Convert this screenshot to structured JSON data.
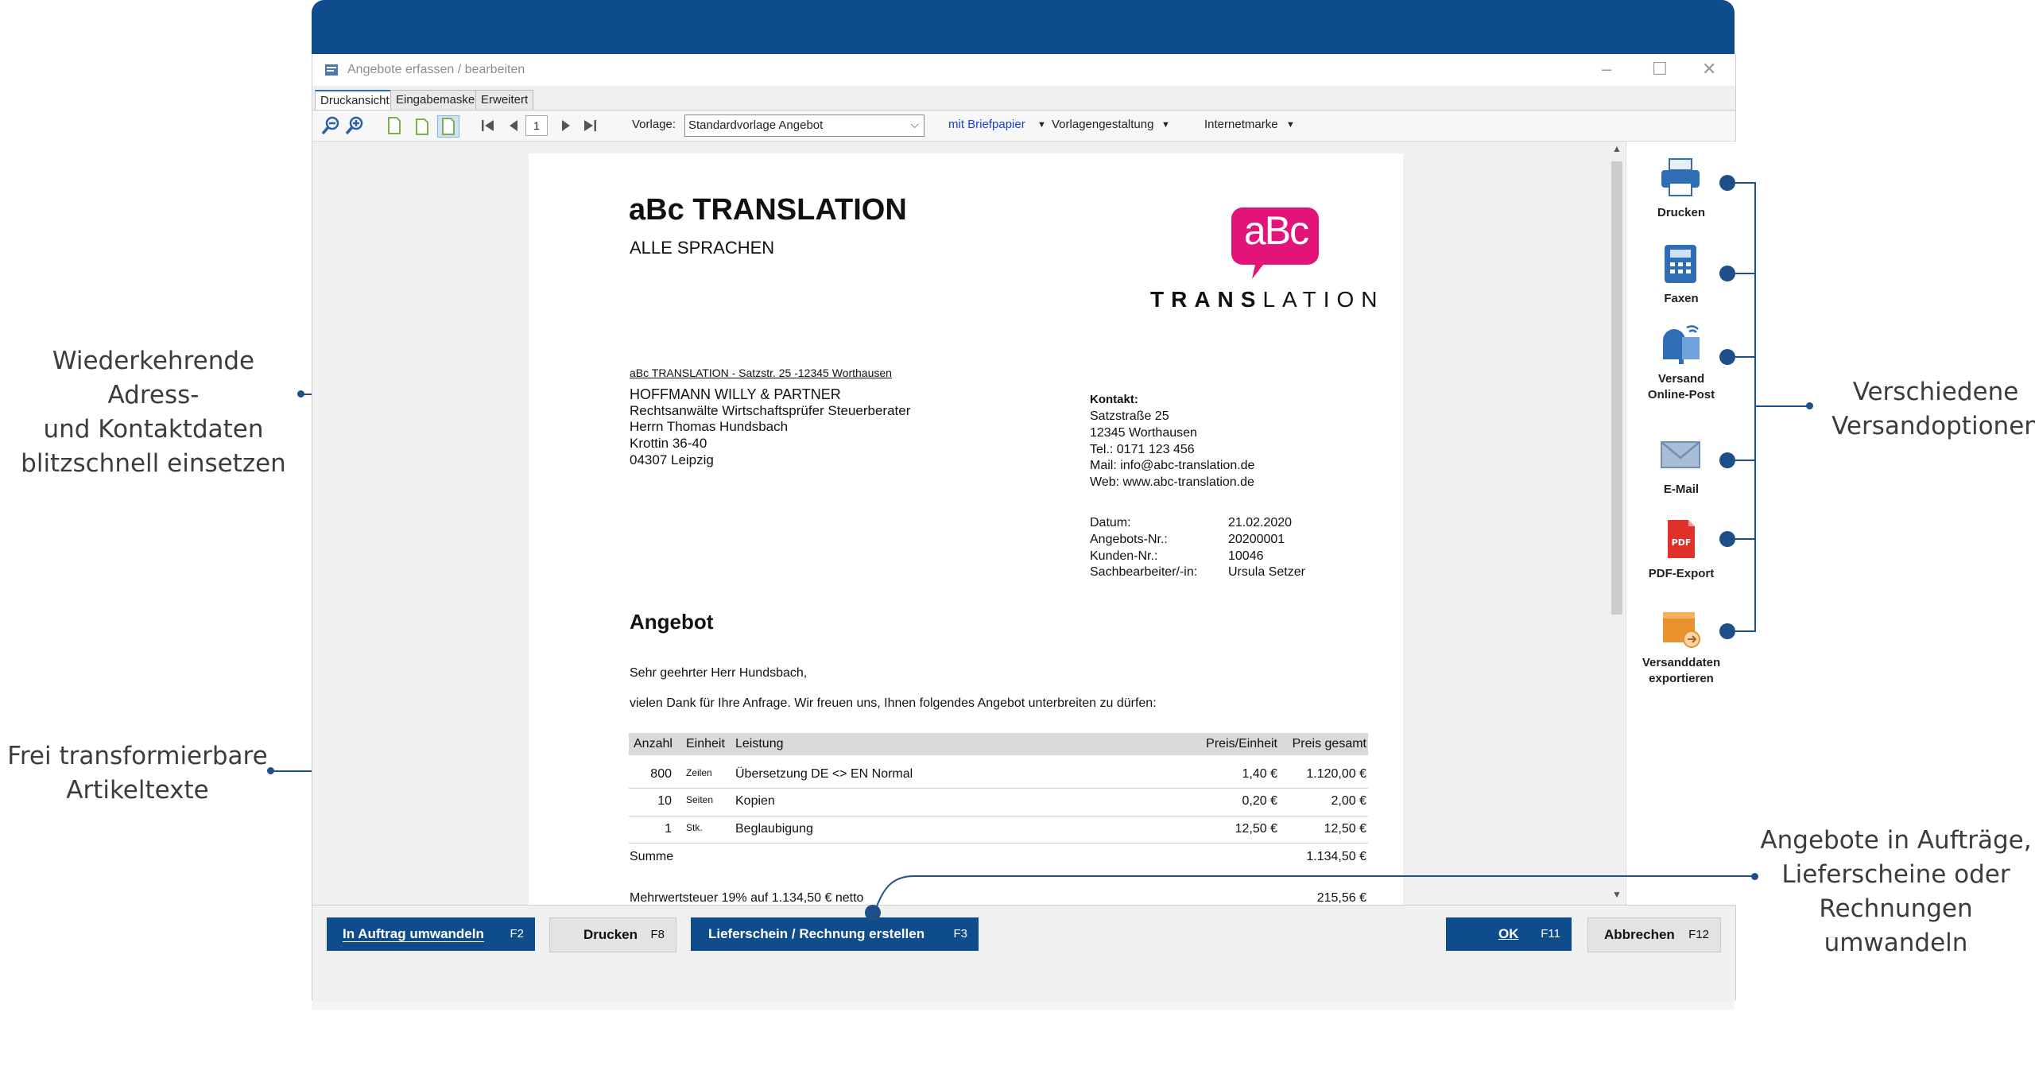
{
  "annotations": {
    "left_top": [
      "Wiederkehrende Adress-",
      "und Kontaktdaten",
      "blitzschnell einsetzen"
    ],
    "left_mid": [
      "Frei transformierbare",
      "Artikeltexte"
    ],
    "right_top": [
      "Verschiedene",
      "Versandoptionen"
    ],
    "right_bottom": [
      "Angebote in Aufträge,",
      "Lieferscheine oder",
      "Rechnungen umwandeln"
    ]
  },
  "window": {
    "title": "Angebote erfassen / bearbeiten",
    "controls": {
      "minimize": "–",
      "maximize": "☐",
      "close": "✕"
    }
  },
  "tabs": [
    {
      "label": "Druckansicht",
      "active": true
    },
    {
      "label": "Eingabemaske",
      "active": false
    },
    {
      "label": "Erweitert",
      "active": false
    }
  ],
  "toolbar": {
    "page_number": "1",
    "template_label": "Vorlage:",
    "template_value": "Standardvorlage Angebot",
    "letterhead": "mit Briefpapier",
    "template_design": "Vorlagengestaltung",
    "internet_stamp": "Internetmarke"
  },
  "document": {
    "company": "aBc TRANSLATION",
    "tagline": "ALLE SPRACHEN",
    "logo_mark": "aBc",
    "logo_word_bold": "TRANS",
    "logo_word_light": "LATION",
    "sender_line": "aBc TRANSLATION - Satzstr. 25 -12345 Worthausen",
    "recipient": [
      "HOFFMANN WILLY & PARTNER",
      "Rechtsanwälte Wirtschaftsprüfer Steuerberater",
      "Herrn Thomas Hundsbach",
      "Krottin 36-40",
      "04307 Leipzig"
    ],
    "contact_heading": "Kontakt:",
    "contact": [
      "Satzstraße 25",
      "12345 Worthausen",
      "Tel.: 0171 123 456",
      "Mail: info@abc-translation.de",
      "Web: www.abc-translation.de"
    ],
    "meta": [
      {
        "label": "Datum:",
        "value": "21.02.2020"
      },
      {
        "label": "Angebots-Nr.:",
        "value": "20200001"
      },
      {
        "label": "Kunden-Nr.:",
        "value": "10046"
      },
      {
        "label": "Sachbearbeiter/-in:",
        "value": "Ursula Setzer"
      }
    ],
    "heading": "Angebot",
    "salutation": "Sehr geehrter Herr Hundsbach,",
    "intro": "vielen Dank für Ihre Anfrage. Wir freuen uns, Ihnen folgendes Angebot unterbreiten zu dürfen:",
    "table": {
      "headers": [
        "Anzahl",
        "Einheit",
        "Leistung",
        "Preis/Einheit",
        "Preis gesamt"
      ],
      "rows": [
        [
          "800",
          "Zeilen",
          "Übersetzung DE <> EN Normal",
          "1,40 €",
          "1.120,00 €"
        ],
        [
          "10",
          "Seiten",
          "Kopien",
          "0,20 €",
          "2,00 €"
        ],
        [
          "1",
          "Stk.",
          "Beglaubigung",
          "12,50 €",
          "12,50 €"
        ]
      ],
      "sum_label": "Summe",
      "sum_value": "1.134,50 €",
      "tax_label": "Mehrwertsteuer 19% auf 1.134,50 € netto",
      "tax_value": "215,56 €"
    }
  },
  "send_options": [
    {
      "label": [
        "Drucken"
      ],
      "icon": "printer-icon",
      "color": "#2f6db5"
    },
    {
      "label": [
        "Faxen"
      ],
      "icon": "fax-icon",
      "color": "#2f6db5"
    },
    {
      "label": [
        "Versand",
        "Online-Post"
      ],
      "icon": "mailbox-icon",
      "color": "#2f6db5"
    },
    {
      "label": [
        "E-Mail"
      ],
      "icon": "envelope-icon",
      "color": "#6f8fb6"
    },
    {
      "label": [
        "PDF-Export"
      ],
      "icon": "pdf-icon",
      "color": "#e0302a"
    },
    {
      "label": [
        "Versanddaten",
        "exportieren"
      ],
      "icon": "box-export-icon",
      "color": "#e8912d"
    }
  ],
  "buttons": {
    "convert_order": {
      "label": "In Auftrag umwandeln",
      "key": "F2"
    },
    "print": {
      "label": "Drucken",
      "key": "F8"
    },
    "delivery_invoice": {
      "label": "Lieferschein / Rechnung erstellen",
      "key": "F3"
    },
    "ok": {
      "label": "OK",
      "key": "F11"
    },
    "cancel": {
      "label": "Abbrechen",
      "key": "F12"
    }
  },
  "colors": {
    "brand_blue": "#0f4c8c",
    "logo_magenta": "#e2147a",
    "annotation_line": "#1f4f8a"
  }
}
